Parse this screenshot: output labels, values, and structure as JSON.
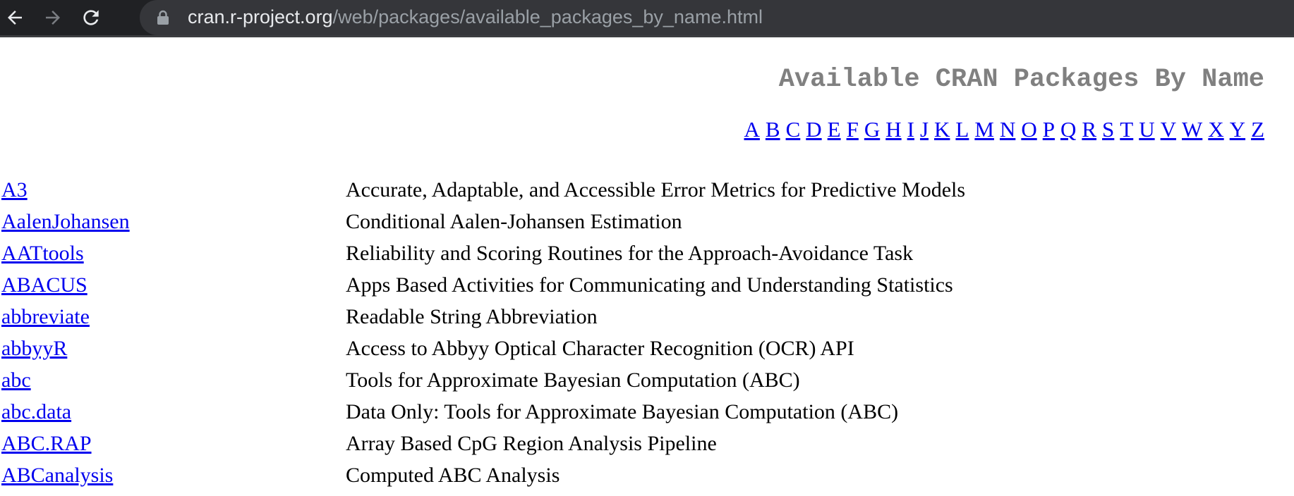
{
  "browser": {
    "url_host": "cran.r-project.org",
    "url_path": "/web/packages/available_packages_by_name.html",
    "back_icon": "arrow-left-icon",
    "forward_icon": "arrow-right-icon",
    "reload_icon": "reload-icon",
    "lock_icon": "lock-icon"
  },
  "page": {
    "title": "Available CRAN Packages By Name",
    "letters": [
      "A",
      "B",
      "C",
      "D",
      "E",
      "F",
      "G",
      "H",
      "I",
      "J",
      "K",
      "L",
      "M",
      "N",
      "O",
      "P",
      "Q",
      "R",
      "S",
      "T",
      "U",
      "V",
      "W",
      "X",
      "Y",
      "Z"
    ]
  },
  "packages": [
    {
      "name": "A3",
      "description": "Accurate, Adaptable, and Accessible Error Metrics for Predictive Models"
    },
    {
      "name": "AalenJohansen",
      "description": "Conditional Aalen-Johansen Estimation"
    },
    {
      "name": "AATtools",
      "description": "Reliability and Scoring Routines for the Approach-Avoidance Task"
    },
    {
      "name": "ABACUS",
      "description": "Apps Based Activities for Communicating and Understanding Statistics"
    },
    {
      "name": "abbreviate",
      "description": "Readable String Abbreviation"
    },
    {
      "name": "abbyyR",
      "description": "Access to Abbyy Optical Character Recognition (OCR) API"
    },
    {
      "name": "abc",
      "description": "Tools for Approximate Bayesian Computation (ABC)"
    },
    {
      "name": "abc.data",
      "description": "Data Only: Tools for Approximate Bayesian Computation (ABC)"
    },
    {
      "name": "ABC.RAP",
      "description": "Array Based CpG Region Analysis Pipeline"
    },
    {
      "name": "ABCanalysis",
      "description": "Computed ABC Analysis"
    }
  ],
  "colors": {
    "toolbar_bg": "#202124",
    "omnibox_bg": "#35363a",
    "link": "#0000ee",
    "title": "#808080"
  }
}
